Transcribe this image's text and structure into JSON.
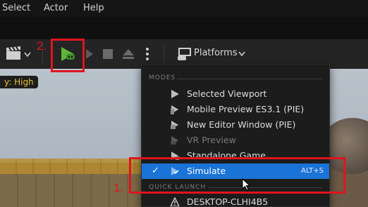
{
  "menubar": {
    "items": [
      "Select",
      "Actor",
      "Help"
    ]
  },
  "toolbar": {
    "platforms_label": "Platforms"
  },
  "viewport": {
    "scalability_label": "y: High"
  },
  "menu": {
    "modes_header": "MODES",
    "items": [
      {
        "label": "Selected Viewport",
        "icon": "play-icon",
        "dim": false
      },
      {
        "label": "Mobile Preview ES3.1 (PIE)",
        "icon": "mobile-preview-icon",
        "dim": false
      },
      {
        "label": "New Editor Window (PIE)",
        "icon": "editor-window-icon",
        "dim": false
      },
      {
        "label": "VR Preview",
        "icon": "vr-icon",
        "dim": true
      },
      {
        "label": "Standalone Game",
        "icon": "standalone-icon",
        "dim": false
      },
      {
        "label": "Simulate",
        "icon": "simulate-icon",
        "dim": false,
        "selected": true,
        "shortcut": "ALT+S"
      }
    ],
    "quick_launch_header": "QUICK LAUNCH",
    "quick_launch_items": [
      {
        "label": "DESKTOP-CLHI4B5",
        "icon": "warning-icon"
      }
    ]
  },
  "annotations": {
    "step1": "1.",
    "step2": "2."
  },
  "colors": {
    "highlight": "#1a73d6",
    "annotation_red": "#e0141e",
    "play_green": "#5fb43a"
  }
}
